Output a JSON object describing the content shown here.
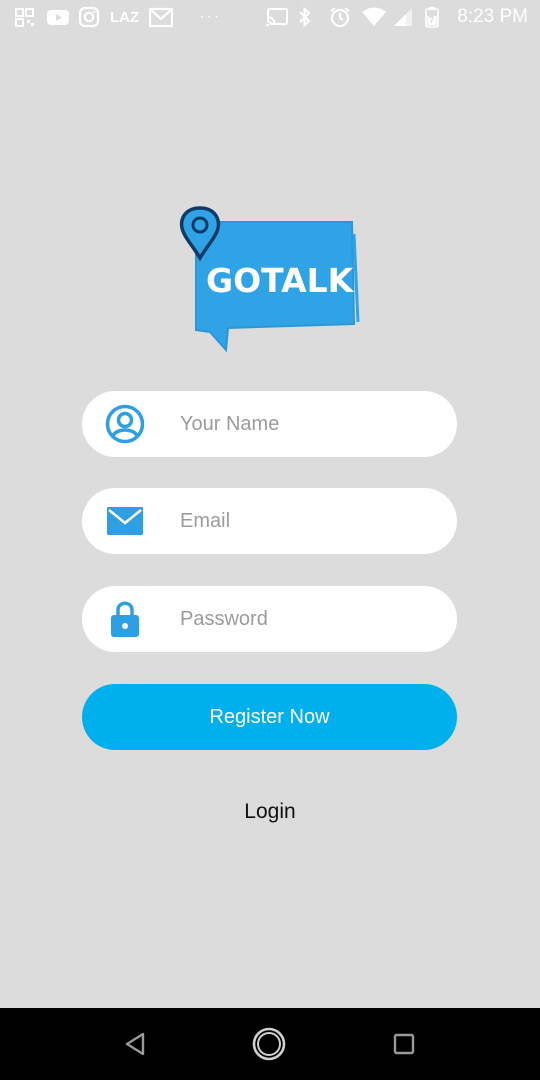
{
  "status_bar": {
    "time": "8:23 PM",
    "laz": "LAZ",
    "overflow": "···",
    "icons_left": [
      "qr-icon",
      "youtube-icon",
      "instagram-icon",
      "lazada-icon",
      "gmail-icon"
    ],
    "icons_right": [
      "cast-icon",
      "bluetooth-icon",
      "alarm-icon",
      "wifi-icon",
      "signal-icon",
      "battery-icon"
    ]
  },
  "logo": {
    "text": "GOTALK",
    "color": "#30a3e6"
  },
  "form": {
    "name_placeholder": "Your Name",
    "email_placeholder": "Email",
    "password_placeholder": "Password",
    "register_label": "Register Now",
    "login_label": "Login"
  },
  "colors": {
    "accent": "#00b0ec",
    "icon": "#2d9fe2",
    "background": "#dcdcdc"
  },
  "nav_bar": {
    "buttons": [
      "back-icon",
      "home-icon",
      "recents-icon"
    ]
  }
}
